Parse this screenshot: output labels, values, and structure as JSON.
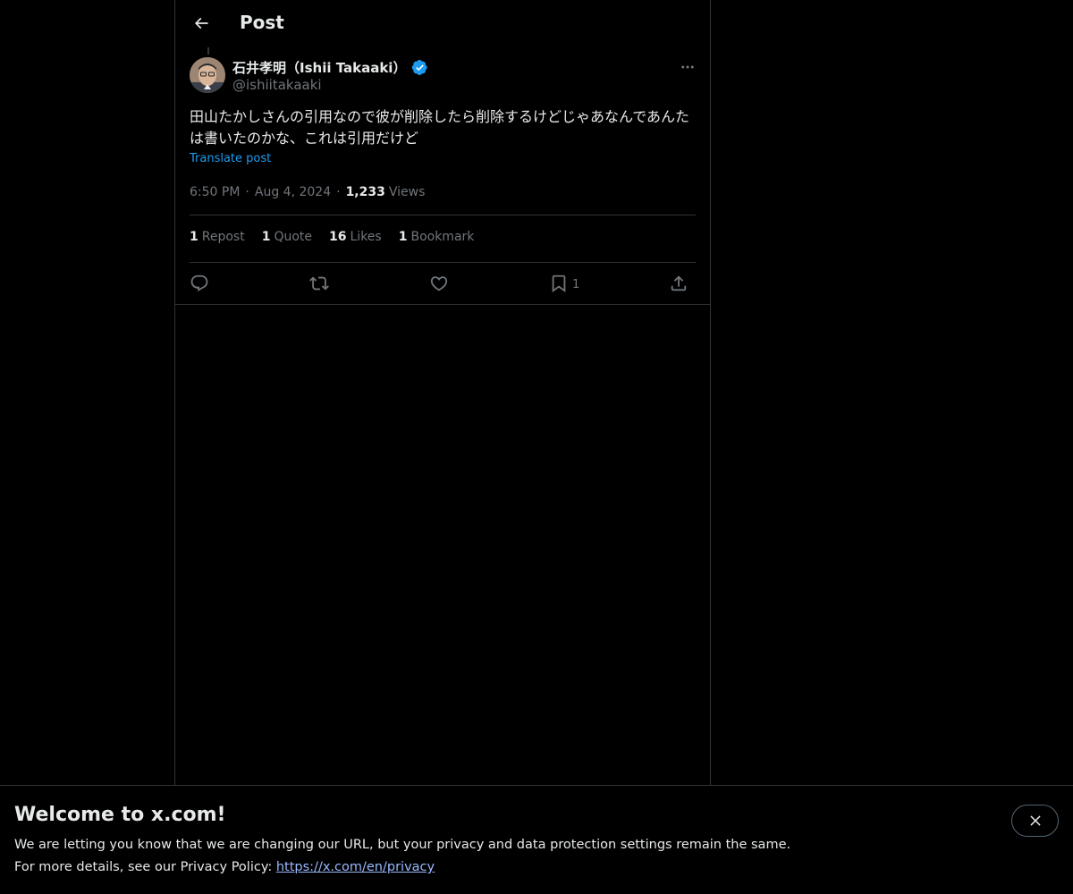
{
  "header": {
    "title": "Post",
    "back_icon": "arrow-left-icon"
  },
  "tweet": {
    "author_name": "石井孝明（Ishii Takaaki）",
    "author_handle": "@ishiitakaaki",
    "verified": true,
    "verified_color": "#1d9bf0",
    "text": "田山たかしさんの引用なので彼が削除したら削除するけどじゃあなんであんたは書いたのかな、これは引用だけど",
    "translate_label": "Translate post",
    "time": "6:50 PM",
    "separator": "·",
    "date": "Aug 4, 2024",
    "views_count": "1,233",
    "views_label": "Views"
  },
  "stats": [
    {
      "count": "1",
      "label": "Repost"
    },
    {
      "count": "1",
      "label": "Quote"
    },
    {
      "count": "16",
      "label": "Likes"
    },
    {
      "count": "1",
      "label": "Bookmark"
    }
  ],
  "actions": {
    "reply_icon": "reply-icon",
    "repost_icon": "repost-icon",
    "like_icon": "heart-icon",
    "bookmark_icon": "bookmark-icon",
    "bookmark_count": "1",
    "share_icon": "share-icon"
  },
  "banner": {
    "title": "Welcome to x.com!",
    "line1": "We are letting you know that we are changing our URL, but your privacy and data protection settings remain the same.",
    "line2_prefix": "For more details, see our Privacy Policy: ",
    "link": "https://x.com/en/privacy",
    "close_icon": "close-icon"
  }
}
